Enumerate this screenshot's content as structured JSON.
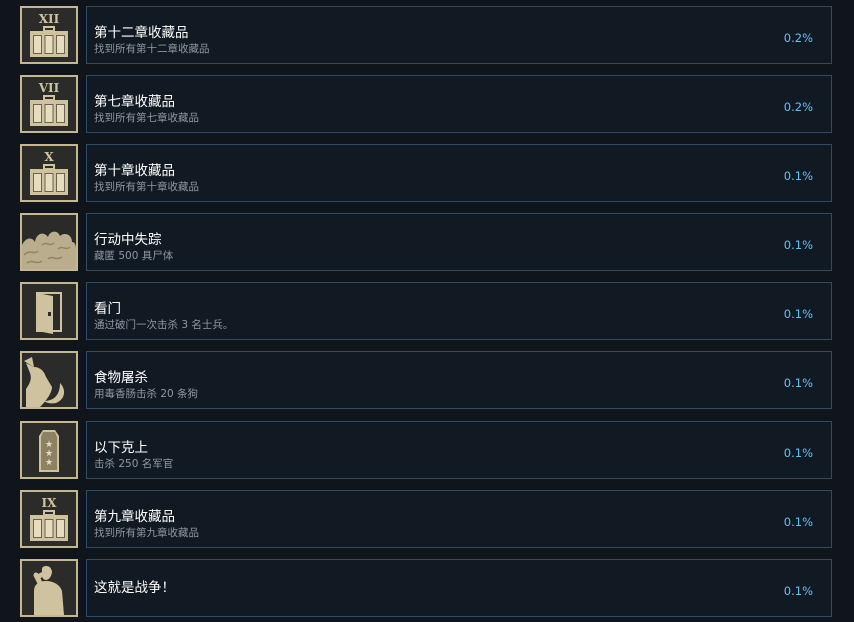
{
  "achievements": [
    {
      "icon": "briefcase-xii-icon",
      "numeral": "XII",
      "title": "第十二章收藏品",
      "description": "找到所有第十二章收藏品",
      "percent": "0.2%"
    },
    {
      "icon": "briefcase-vii-icon",
      "numeral": "VII",
      "title": "第七章收藏品",
      "description": "找到所有第七章收藏品",
      "percent": "0.2%"
    },
    {
      "icon": "briefcase-x-icon",
      "numeral": "X",
      "title": "第十章收藏品",
      "description": "找到所有第十章收藏品",
      "percent": "0.1%"
    },
    {
      "icon": "smoke-cloud-icon",
      "numeral": "",
      "title": "行动中失踪",
      "description": "藏匿 500 具尸体",
      "percent": "0.1%"
    },
    {
      "icon": "door-icon",
      "numeral": "",
      "title": "看门",
      "description": "通过破门一次击杀 3 名士兵。",
      "percent": "0.1%"
    },
    {
      "icon": "dog-sausage-icon",
      "numeral": "",
      "title": "食物屠杀",
      "description": "用毒香肠击杀 20 条狗",
      "percent": "0.1%"
    },
    {
      "icon": "officer-rank-insignia-icon",
      "numeral": "",
      "title": "以下克上",
      "description": "击杀 250 名军官",
      "percent": "0.1%"
    },
    {
      "icon": "briefcase-ix-icon",
      "numeral": "IX",
      "title": "第九章收藏品",
      "description": "找到所有第九章收藏品",
      "percent": "0.1%"
    },
    {
      "icon": "saluting-soldier-icon",
      "numeral": "",
      "title": "这就是战争！",
      "description": "",
      "percent": "0.1%"
    }
  ]
}
